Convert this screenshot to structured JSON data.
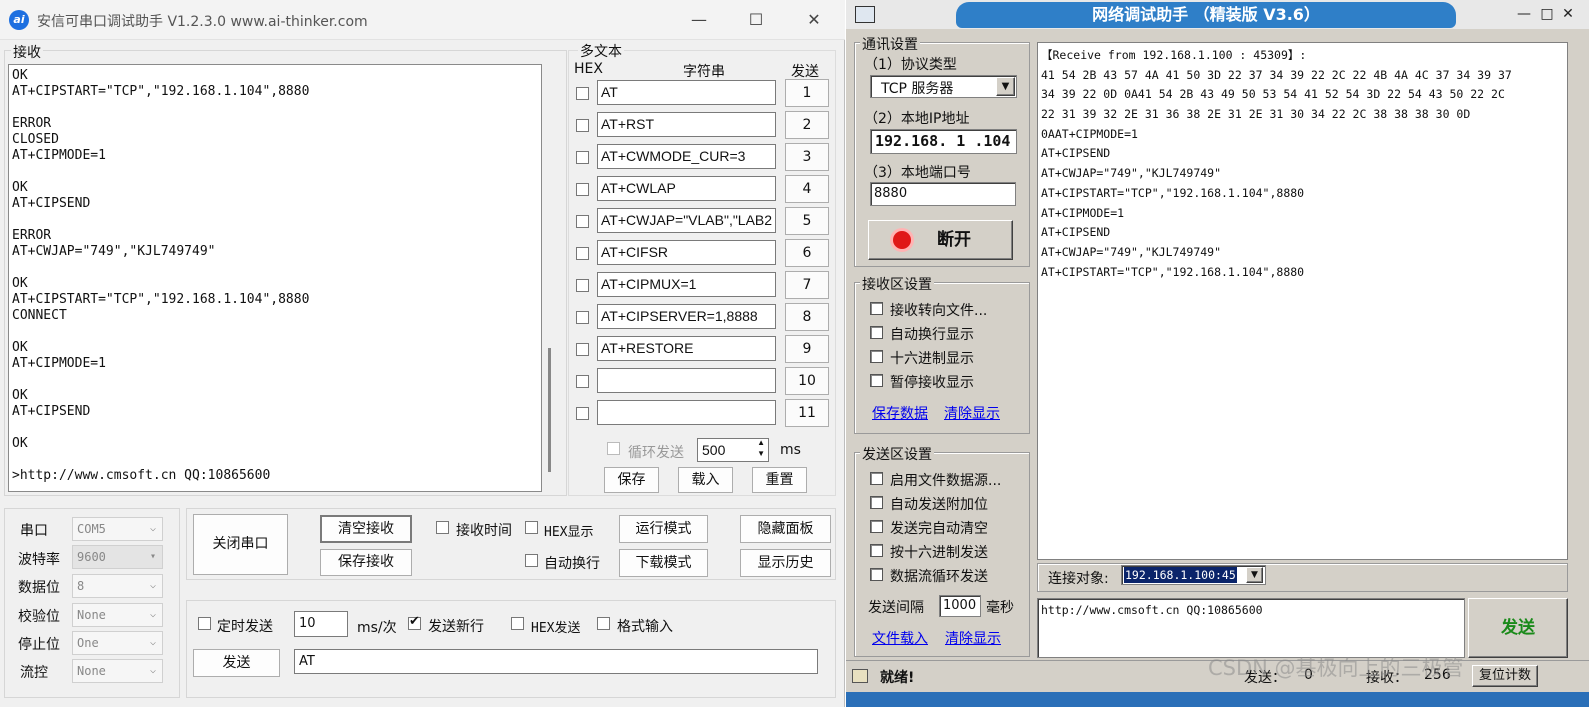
{
  "left_window": {
    "title": "安信可串口调试助手 V1.2.3.0     www.ai-thinker.com",
    "logo_text": "ai",
    "controls": {
      "minimize": "—",
      "maximize": "☐",
      "close": "✕"
    },
    "receive": {
      "label": "接收",
      "lines": [
        "OK",
        "AT+CIPSTART=\"TCP\",\"192.168.1.104\",8880",
        "",
        "ERROR",
        "CLOSED",
        "AT+CIPMODE=1",
        "",
        "OK",
        "AT+CIPSEND",
        "",
        "ERROR",
        "AT+CWJAP=\"749\",\"KJL749749\"",
        "",
        "OK",
        "AT+CIPSTART=\"TCP\",\"192.168.1.104\",8880",
        "CONNECT",
        "",
        "OK",
        "AT+CIPMODE=1",
        "",
        "OK",
        "AT+CIPSEND",
        "",
        "OK",
        "",
        ">http://www.cmsoft.cn QQ:10865600"
      ]
    },
    "multi_text": {
      "title": "多文本",
      "col_hex": "HEX",
      "col_string": "字符串",
      "col_send": "发送",
      "rows": [
        {
          "text": "AT",
          "num": "1"
        },
        {
          "text": "AT+RST",
          "num": "2"
        },
        {
          "text": "AT+CWMODE_CUR=3",
          "num": "3"
        },
        {
          "text": "AT+CWLAP",
          "num": "4"
        },
        {
          "text": "AT+CWJAP=\"VLAB\",\"LAB2",
          "num": "5"
        },
        {
          "text": "AT+CIFSR",
          "num": "6"
        },
        {
          "text": "AT+CIPMUX=1",
          "num": "7"
        },
        {
          "text": "AT+CIPSERVER=1,8888",
          "num": "8"
        },
        {
          "text": "AT+RESTORE",
          "num": "9"
        },
        {
          "text": "",
          "num": "10"
        },
        {
          "text": "",
          "num": "11"
        }
      ],
      "loop_label": "循环发送",
      "loop_value": "500",
      "loop_unit": "ms",
      "save": "保存",
      "load": "载入",
      "reset": "重置"
    },
    "serial": {
      "port_label": "串口",
      "port_value": "COM5",
      "baud_label": "波特率",
      "baud_value": "9600",
      "data_label": "数据位",
      "data_value": "8",
      "parity_label": "校验位",
      "parity_value": "None",
      "stop_label": "停止位",
      "stop_value": "One",
      "flow_label": "流控",
      "flow_value": "None"
    },
    "buttons": {
      "close_port": "关闭串口",
      "clear_recv": "清空接收",
      "save_recv": "保存接收",
      "recv_time": "接收时间",
      "hex_display": "HEX显示",
      "run_mode": "运行模式",
      "hide_panel": "隐藏面板",
      "auto_wrap": "自动换行",
      "download_mode": "下载模式",
      "show_history": "显示历史"
    },
    "send": {
      "timed_send": "定时发送",
      "interval": "10",
      "interval_unit": "ms/次",
      "send_newline": "发送新行",
      "hex_send": "HEX发送",
      "format_input": "格式输入",
      "send_button": "发送",
      "send_text": "AT"
    }
  },
  "right_window": {
    "title": "网络调试助手 （精装版 V3.6）",
    "controls": {
      "minimize": "—",
      "maximize": "□",
      "close": "✕"
    },
    "comm_settings": {
      "title": "通讯设置",
      "protocol_label": "（1）协议类型",
      "protocol_value": "TCP 服务器",
      "ip_label": "（2）本地IP地址",
      "ip_value": "192.168. 1 .104",
      "port_label": "（3）本地端口号",
      "port_value": "8880",
      "disconnect": "断开"
    },
    "recv_settings": {
      "title": "接收区设置",
      "opt1": "接收转向文件...",
      "opt2": "自动换行显示",
      "opt3": "十六进制显示",
      "opt4": "暂停接收显示",
      "save_data": "保存数据",
      "clear_display": "清除显示"
    },
    "send_settings": {
      "title": "发送区设置",
      "opt1": "启用文件数据源...",
      "opt2": "自动发送附加位",
      "opt3": "发送完自动清空",
      "opt4": "按十六进制发送",
      "opt5": "数据流循环发送",
      "interval_label": "发送间隔",
      "interval_value": "1000",
      "interval_unit": "毫秒",
      "file_load": "文件载入",
      "clear_display": "清除显示"
    },
    "receive_lines": [
      "【Receive from 192.168.1.100 : 45309】:",
      "41 54 2B 43 57 4A 41 50 3D 22 37 34 39 22 2C 22 4B 4A 4C 37 34 39 37",
      "34 39 22 0D 0A41 54 2B 43 49 50 53 54 41 52 54 3D 22 54 43 50 22 2C",
      "22 31 39 32 2E 31 36 38 2E 31 2E 31 30 34 22 2C 38 38 38 30 0D",
      "0AAT+CIPMODE=1",
      "AT+CIPSEND",
      "AT+CWJAP=\"749\",\"KJL749749\"",
      "AT+CIPSTART=\"TCP\",\"192.168.1.104\",8880",
      "AT+CIPMODE=1",
      "AT+CIPSEND",
      "AT+CWJAP=\"749\",\"KJL749749\"",
      "AT+CIPSTART=\"TCP\",\"192.168.1.104\",8880"
    ],
    "connect_target_label": "连接对象:",
    "connect_target_value": "192.168.1.100:45",
    "send_text": "http://www.cmsoft.cn QQ:10865600",
    "send_button": "发送",
    "status": {
      "ready": "就绪!",
      "send_label": "发送：",
      "send_count": "0",
      "recv_label": "接收：",
      "recv_count": "256",
      "reset_count": "复位计数"
    },
    "watermark": "CSDN @基极向上的三极管"
  }
}
